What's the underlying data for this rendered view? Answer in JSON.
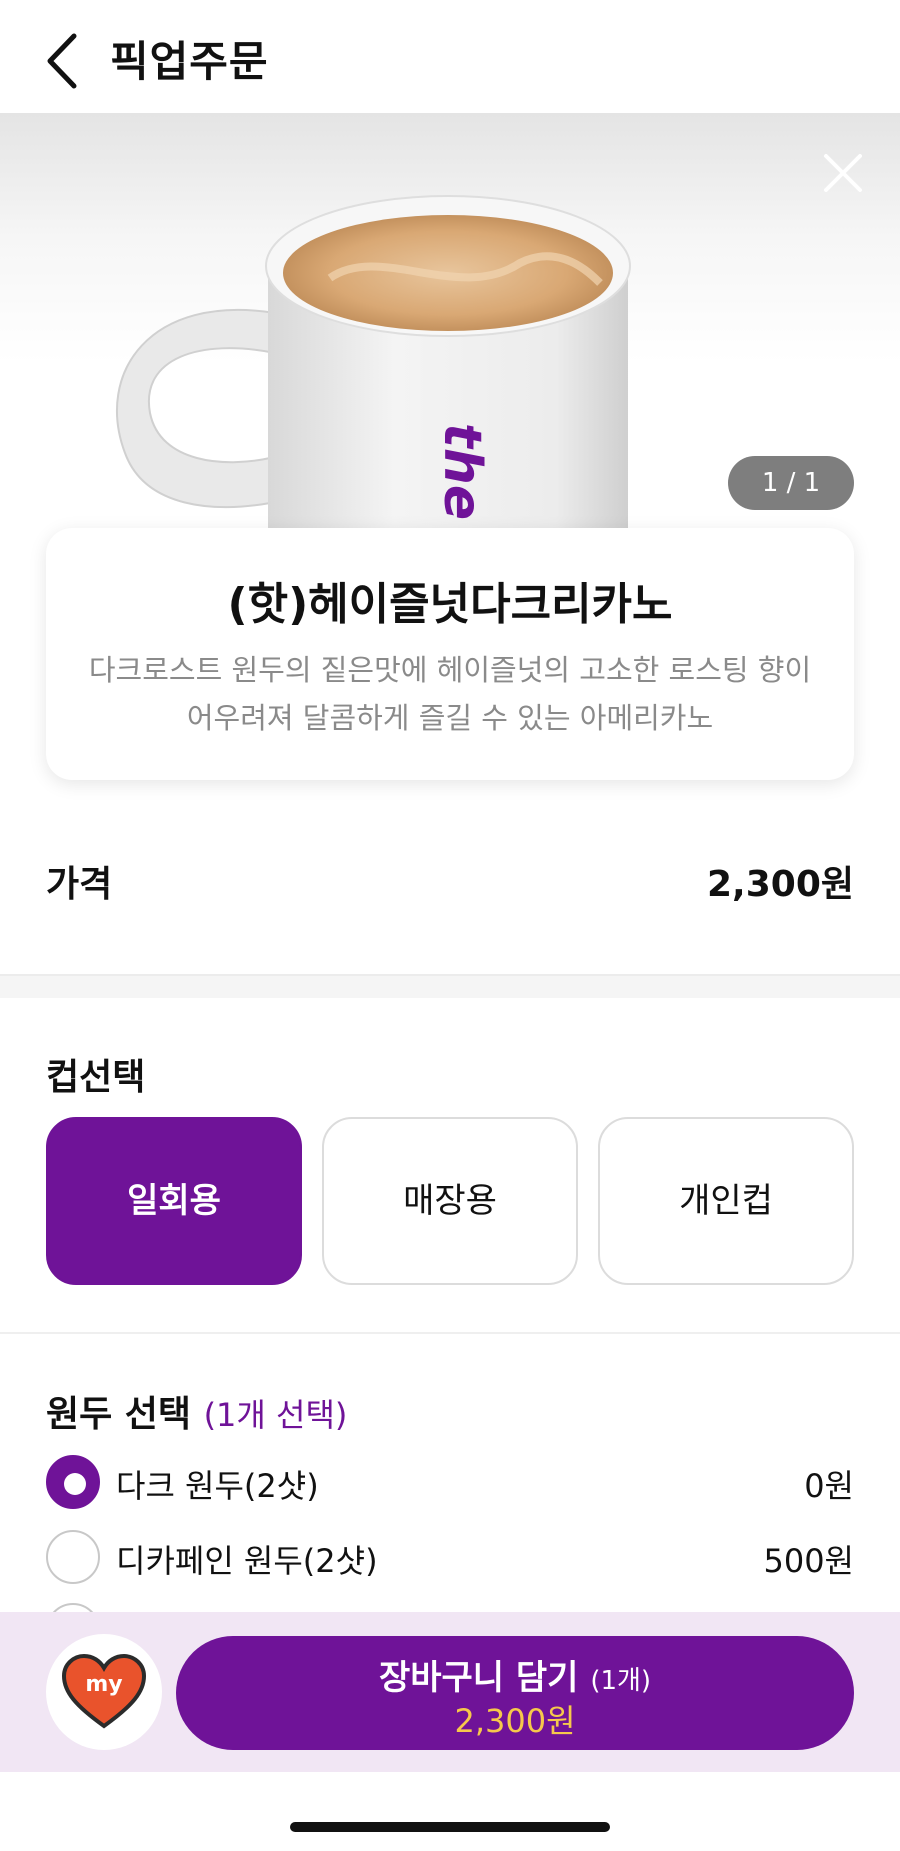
{
  "header": {
    "title": "픽업주문",
    "back_icon": "chevron-left-icon"
  },
  "hero": {
    "close_icon": "close-icon",
    "image_counter": "1 / 1",
    "mug_brand_text": "the"
  },
  "product": {
    "name": "(핫)헤이즐넛다크리카노",
    "description": "다크로스트 원두의 짙은맛에 헤이즐넛의 고소한 로스팅 향이 어우려져 달콤하게 즐길 수 있는 아메리카노"
  },
  "price": {
    "label": "가격",
    "value": "2,300원"
  },
  "cup_select": {
    "title": "컵선택",
    "options": [
      "일회용",
      "매장용",
      "개인컵"
    ],
    "selected": "일회용"
  },
  "bean_select": {
    "title": "원두 선택",
    "subtitle": "(1개 선택)",
    "options": [
      {
        "label": "다크 원두(2샷)",
        "price": "0원",
        "checked": true
      },
      {
        "label": "디카페인 원두(2샷)",
        "price": "500원",
        "checked": false
      }
    ]
  },
  "bottom_bar": {
    "my_icon_text": "my",
    "cart_label": "장바구니 담기",
    "cart_qty": "(1개)",
    "cart_price": "2,300원"
  },
  "colors": {
    "accent": "#6f1398",
    "price_highlight": "#f6c84b",
    "bar_bg": "#f1e6f4"
  }
}
